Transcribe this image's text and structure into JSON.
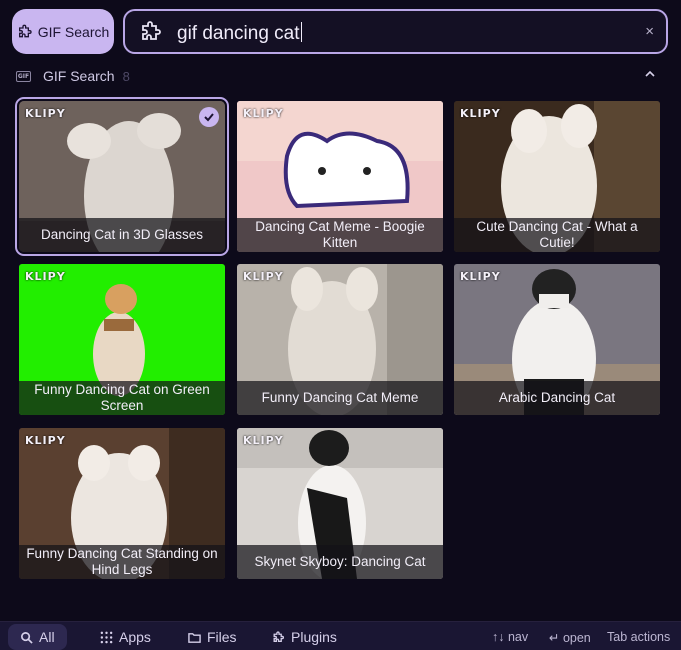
{
  "mode_chip": {
    "label": "GIF Search",
    "icon": "puzzle-icon"
  },
  "search": {
    "value": "gif dancing cat",
    "clear_icon": "×"
  },
  "section": {
    "title": "GIF Search",
    "count": "8"
  },
  "cards": [
    {
      "caption": "Dancing Cat in 3D Glasses",
      "logo": "KLIPY",
      "selected": true
    },
    {
      "caption": "Dancing Cat Meme - Boogie Kitten",
      "logo": "KLIPY",
      "selected": false
    },
    {
      "caption": "Cute Dancing Cat - What a Cutie!",
      "logo": "KLIPY",
      "selected": false
    },
    {
      "caption": "Funny Dancing Cat on Green Screen",
      "logo": "KLIPY",
      "selected": false
    },
    {
      "caption": "Funny Dancing Cat Meme",
      "logo": "KLIPY",
      "selected": false
    },
    {
      "caption": "Arabic Dancing Cat",
      "logo": "KLIPY",
      "selected": false
    },
    {
      "caption": "Funny Dancing Cat Standing on Hind Legs",
      "logo": "KLIPY",
      "selected": false
    },
    {
      "caption": "Skynet Skyboy: Dancing Cat",
      "logo": "KLIPY",
      "selected": false
    }
  ],
  "filters": [
    {
      "label": "All",
      "icon": "search-icon",
      "active": true
    },
    {
      "label": "Apps",
      "icon": "grid-icon",
      "active": false
    },
    {
      "label": "Files",
      "icon": "folder-icon",
      "active": false
    },
    {
      "label": "Plugins",
      "icon": "puzzle-icon",
      "active": false
    }
  ],
  "hints": {
    "nav": "↑↓ nav",
    "open": "↵ open",
    "actions": "Tab actions"
  },
  "colors": {
    "accent": "#c9b6f0",
    "border": "#b9a6e6",
    "background": "#0d0a1a",
    "bottom_bar": "#1a1633"
  }
}
